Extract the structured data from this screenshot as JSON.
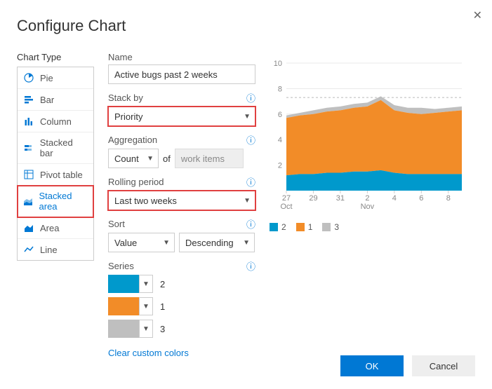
{
  "dialog": {
    "title": "Configure Chart",
    "close_icon": "close"
  },
  "sections": {
    "chart_type_label": "Chart Type",
    "name_label": "Name",
    "stack_by_label": "Stack by",
    "aggregation_label": "Aggregation",
    "rolling_period_label": "Rolling period",
    "sort_label": "Sort",
    "series_label": "Series"
  },
  "chart_types": [
    {
      "id": "pie",
      "label": "Pie",
      "selected": false
    },
    {
      "id": "bar",
      "label": "Bar",
      "selected": false
    },
    {
      "id": "column",
      "label": "Column",
      "selected": false
    },
    {
      "id": "stacked-bar",
      "label": "Stacked bar",
      "selected": false
    },
    {
      "id": "pivot-table",
      "label": "Pivot table",
      "selected": false
    },
    {
      "id": "stacked-area",
      "label": "Stacked area",
      "selected": true
    },
    {
      "id": "area",
      "label": "Area",
      "selected": false
    },
    {
      "id": "line",
      "label": "Line",
      "selected": false
    }
  ],
  "form": {
    "name_value": "Active bugs past 2 weeks",
    "stack_by_value": "Priority",
    "aggregation_value": "Count",
    "aggregation_of_word": "of",
    "aggregation_target": "work items",
    "rolling_period_value": "Last two weeks",
    "sort_field": "Value",
    "sort_direction": "Descending",
    "clear_colors_label": "Clear custom colors"
  },
  "series": [
    {
      "label": "2",
      "color": "#0099cc"
    },
    {
      "label": "1",
      "color": "#f28c28"
    },
    {
      "label": "3",
      "color": "#bfbfbf"
    }
  ],
  "colors": {
    "series2": "#0099cc",
    "series1": "#f28c28",
    "series3": "#bfbfbf",
    "axis": "#d0d0d0",
    "tick_text": "#888"
  },
  "buttons": {
    "ok": "OK",
    "cancel": "Cancel"
  },
  "chart_data": {
    "type": "area",
    "stacked": true,
    "title": "",
    "xlabel": "",
    "ylabel": "",
    "ylim": [
      0,
      10
    ],
    "yticks": [
      2,
      4,
      6,
      8,
      10
    ],
    "x": [
      "27",
      "28",
      "29",
      "30",
      "31",
      "1",
      "2",
      "3",
      "4",
      "5",
      "6",
      "7",
      "8",
      "9"
    ],
    "xtick_labels": [
      "27",
      "29",
      "31",
      "2",
      "4",
      "6",
      "8"
    ],
    "xtick_month_labels": {
      "27": "Oct",
      "2": "Nov"
    },
    "series": [
      {
        "name": "2",
        "color": "#0099cc",
        "values": [
          1.2,
          1.3,
          1.3,
          1.4,
          1.4,
          1.5,
          1.5,
          1.6,
          1.4,
          1.3,
          1.3,
          1.3,
          1.3,
          1.3
        ]
      },
      {
        "name": "1",
        "color": "#f28c28",
        "values": [
          4.5,
          4.6,
          4.7,
          4.8,
          4.9,
          5.0,
          5.1,
          5.5,
          4.9,
          4.8,
          4.7,
          4.8,
          4.9,
          5.0
        ]
      },
      {
        "name": "3",
        "color": "#bfbfbf",
        "values": [
          0.2,
          0.2,
          0.3,
          0.3,
          0.3,
          0.3,
          0.3,
          0.3,
          0.4,
          0.4,
          0.5,
          0.3,
          0.3,
          0.3
        ]
      }
    ],
    "goal_line": 7.3,
    "legend": [
      "2",
      "1",
      "3"
    ]
  }
}
